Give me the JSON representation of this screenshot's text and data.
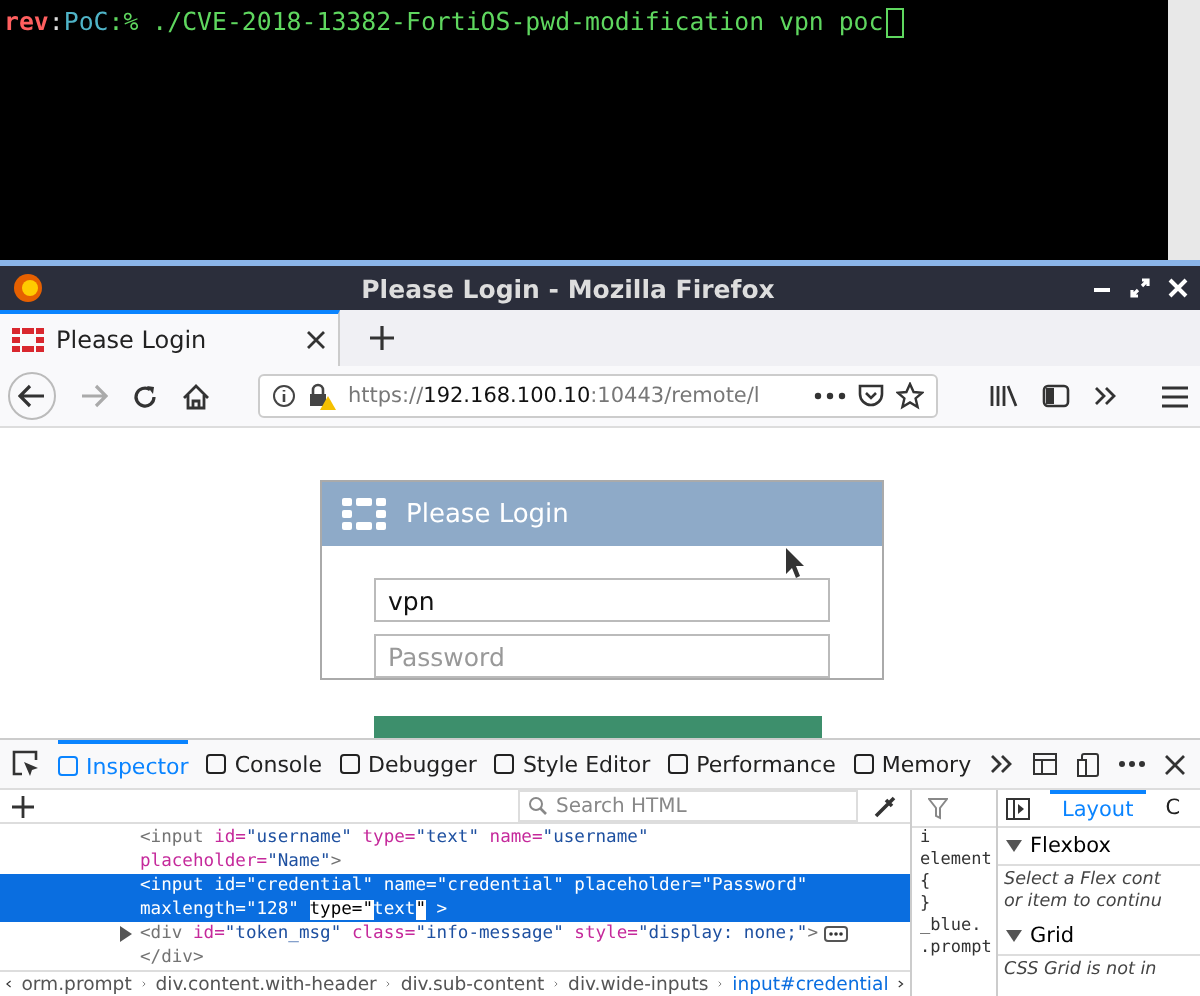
{
  "terminal": {
    "user": "rev",
    "separator": ":",
    "host": "PoC",
    "symbol": ":%",
    "command": "./CVE-2018-13382-FortiOS-pwd-modification vpn poc"
  },
  "window": {
    "title": "Please Login - Mozilla Firefox"
  },
  "tabs": [
    {
      "label": "Please Login",
      "selected": true
    }
  ],
  "url": {
    "scheme": "https://",
    "host": "192.168.100.10",
    "rest": ":10443/remote/l"
  },
  "nav": {
    "forward_disabled": true
  },
  "login": {
    "title": "Please Login",
    "username_value": "vpn",
    "password_placeholder": "Password"
  },
  "devtools": {
    "tabs": [
      {
        "label": "Inspector",
        "selected": true
      },
      {
        "label": "Console",
        "selected": false
      },
      {
        "label": "Debugger",
        "selected": false
      },
      {
        "label": "Style Editor",
        "selected": false
      },
      {
        "label": "Performance",
        "selected": false
      },
      {
        "label": "Memory",
        "selected": false
      }
    ],
    "search_placeholder": "Search HTML",
    "markup": [
      {
        "selected": false,
        "expander": false,
        "segments": [
          {
            "kind": "tag",
            "text": "<input "
          },
          {
            "kind": "attr",
            "text": "id="
          },
          {
            "kind": "value",
            "text": "\"username\" "
          },
          {
            "kind": "attr",
            "text": "type="
          },
          {
            "kind": "value",
            "text": "\"text\" "
          },
          {
            "kind": "attr",
            "text": "name="
          },
          {
            "kind": "value",
            "text": "\"username\""
          }
        ]
      },
      {
        "selected": false,
        "expander": false,
        "segments": [
          {
            "kind": "attr",
            "text": "placeholder="
          },
          {
            "kind": "value",
            "text": "\"Name\""
          },
          {
            "kind": "tag",
            "text": ">"
          }
        ]
      },
      {
        "selected": true,
        "expander": false,
        "segments": [
          {
            "kind": "tag",
            "text": "<input "
          },
          {
            "kind": "attr",
            "text": "id="
          },
          {
            "kind": "value",
            "text": "\"credential\" "
          },
          {
            "kind": "attr",
            "text": "name="
          },
          {
            "kind": "value",
            "text": "\"credential\" "
          },
          {
            "kind": "attr",
            "text": "placeholder="
          },
          {
            "kind": "value",
            "text": "\"Password\""
          }
        ]
      },
      {
        "selected": true,
        "expander": false,
        "segments": [
          {
            "kind": "attr",
            "text": "maxlength="
          },
          {
            "kind": "value",
            "text": "\"128\" "
          },
          {
            "kind": "edit",
            "text": "type=\""
          },
          {
            "kind": "value",
            "text": "text"
          },
          {
            "kind": "edit",
            "text": "\""
          },
          {
            "kind": "tag",
            "text": " >"
          }
        ]
      },
      {
        "selected": false,
        "expander": true,
        "segments": [
          {
            "kind": "tag",
            "text": "<div "
          },
          {
            "kind": "attr",
            "text": "id="
          },
          {
            "kind": "value",
            "text": "\"token_msg\" "
          },
          {
            "kind": "attr",
            "text": "class="
          },
          {
            "kind": "value",
            "text": "\"info-message\" "
          },
          {
            "kind": "attr",
            "text": "style="
          },
          {
            "kind": "value",
            "text": "\"display: none;\""
          },
          {
            "kind": "tag",
            "text": ">"
          }
        ]
      },
      {
        "selected": false,
        "expander": false,
        "segments": [
          {
            "kind": "tag",
            "text": "</div>"
          }
        ]
      }
    ],
    "rules": [
      "i",
      "element",
      "{",
      "}",
      "_blue.",
      ".prompt"
    ],
    "breadcrumbs": [
      {
        "label": "orm.prompt",
        "selected": false
      },
      {
        "label": "div.content.with-header",
        "selected": false
      },
      {
        "label": "div.sub-content",
        "selected": false
      },
      {
        "label": "div.wide-inputs",
        "selected": false
      },
      {
        "label": "input#credential",
        "selected": true
      }
    ],
    "side_tabs": [
      {
        "label": "Layout",
        "selected": true
      },
      {
        "label": "C",
        "selected": false
      }
    ],
    "sections": [
      {
        "title": "Flexbox",
        "lines": [
          "Select a Flex cont",
          "or item to continu"
        ]
      },
      {
        "title": "Grid",
        "lines": [
          "CSS Grid is not in"
        ]
      }
    ]
  }
}
